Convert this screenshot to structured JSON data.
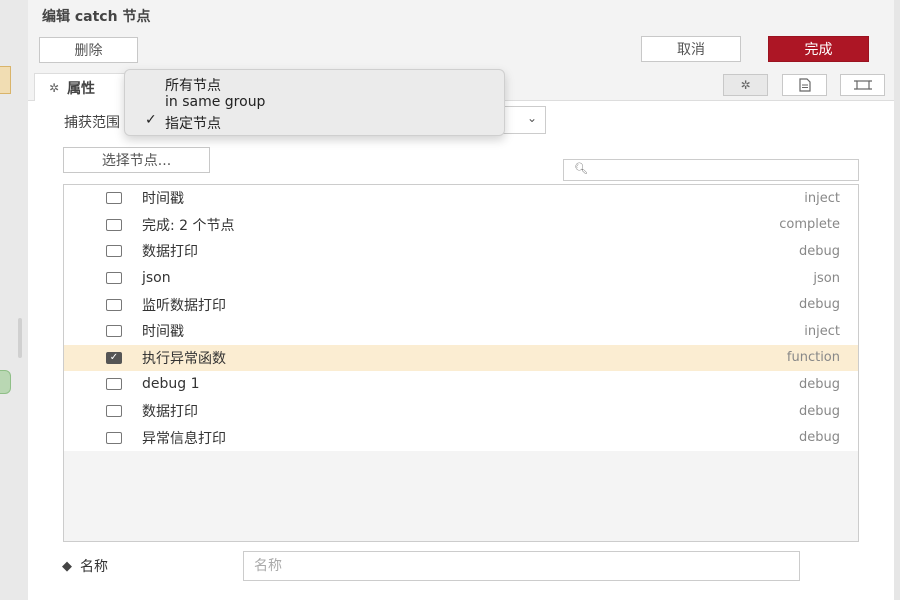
{
  "header": {
    "title": "编辑 catch 节点"
  },
  "toolbar": {
    "delete_label": "删除",
    "cancel_label": "取消",
    "done_label": "完成",
    "done_color": "#ad1625"
  },
  "tabs": {
    "properties_label": "属性"
  },
  "scope": {
    "label": "捕获范围",
    "options": [
      "所有节点",
      "in same group",
      "指定节点"
    ],
    "selected": "指定节点"
  },
  "select_nodes_label": "选择节点...",
  "search": {
    "placeholder": ""
  },
  "nodes": [
    {
      "name": "时间戳",
      "type": "inject",
      "checked": false
    },
    {
      "name": "完成: 2 个节点",
      "type": "complete",
      "checked": false
    },
    {
      "name": "数据打印",
      "type": "debug",
      "checked": false
    },
    {
      "name": "json",
      "type": "json",
      "checked": false
    },
    {
      "name": "监听数据打印",
      "type": "debug",
      "checked": false
    },
    {
      "name": "时间戳",
      "type": "inject",
      "checked": false
    },
    {
      "name": "执行异常函数",
      "type": "function",
      "checked": true
    },
    {
      "name": "debug 1",
      "type": "debug",
      "checked": false
    },
    {
      "name": "数据打印",
      "type": "debug",
      "checked": false
    },
    {
      "name": "异常信息打印",
      "type": "debug",
      "checked": false
    }
  ],
  "name_field": {
    "label": "名称",
    "placeholder": "名称",
    "value": ""
  },
  "colors": {
    "selected_row": "#fbedd2",
    "primary": "#ad1625"
  }
}
